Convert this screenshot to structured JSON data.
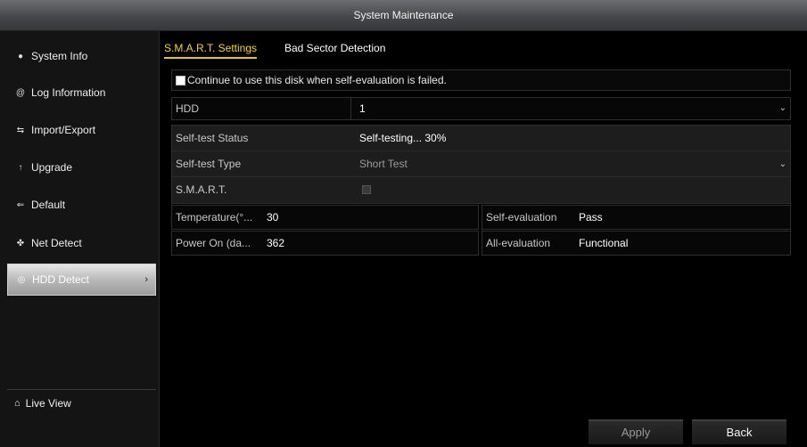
{
  "window": {
    "title": "System Maintenance"
  },
  "sidebar": {
    "items": [
      {
        "label": "System Info",
        "icon": "info-icon"
      },
      {
        "label": "Log Information",
        "icon": "log-icon"
      },
      {
        "label": "Import/Export",
        "icon": "import-export-icon"
      },
      {
        "label": "Upgrade",
        "icon": "upgrade-icon"
      },
      {
        "label": "Default",
        "icon": "default-icon"
      },
      {
        "label": "Net Detect",
        "icon": "network-icon"
      },
      {
        "label": "HDD Detect",
        "icon": "hdd-icon",
        "active": true
      }
    ],
    "live_view": "Live View"
  },
  "tabs": [
    {
      "label": "S.M.A.R.T. Settings",
      "active": true
    },
    {
      "label": "Bad Sector Detection",
      "active": false
    }
  ],
  "form": {
    "continue_checkbox_label": "Continue to use this disk when self-evaluation is failed.",
    "continue_checked": false,
    "hdd_label": "HDD",
    "hdd_value": "1",
    "selftest_status_label": "Self-test Status",
    "selftest_status_value": "Self-testing... 30%",
    "selftest_type_label": "Self-test Type",
    "selftest_type_value": "Short Test",
    "smart_label": "S.M.A.R.T.",
    "temperature_label": "Temperature(°...",
    "temperature_value": "30",
    "power_on_label": "Power On (da...",
    "power_on_value": "362",
    "self_evaluation_label": "Self-evaluation",
    "self_evaluation_value": "Pass",
    "all_evaluation_label": "All-evaluation",
    "all_evaluation_value": "Functional"
  },
  "buttons": {
    "apply": "Apply",
    "back": "Back"
  },
  "colors": {
    "active_tab": "#f3d42b",
    "active_nav": "#b9b9b9",
    "background": "#000000"
  }
}
